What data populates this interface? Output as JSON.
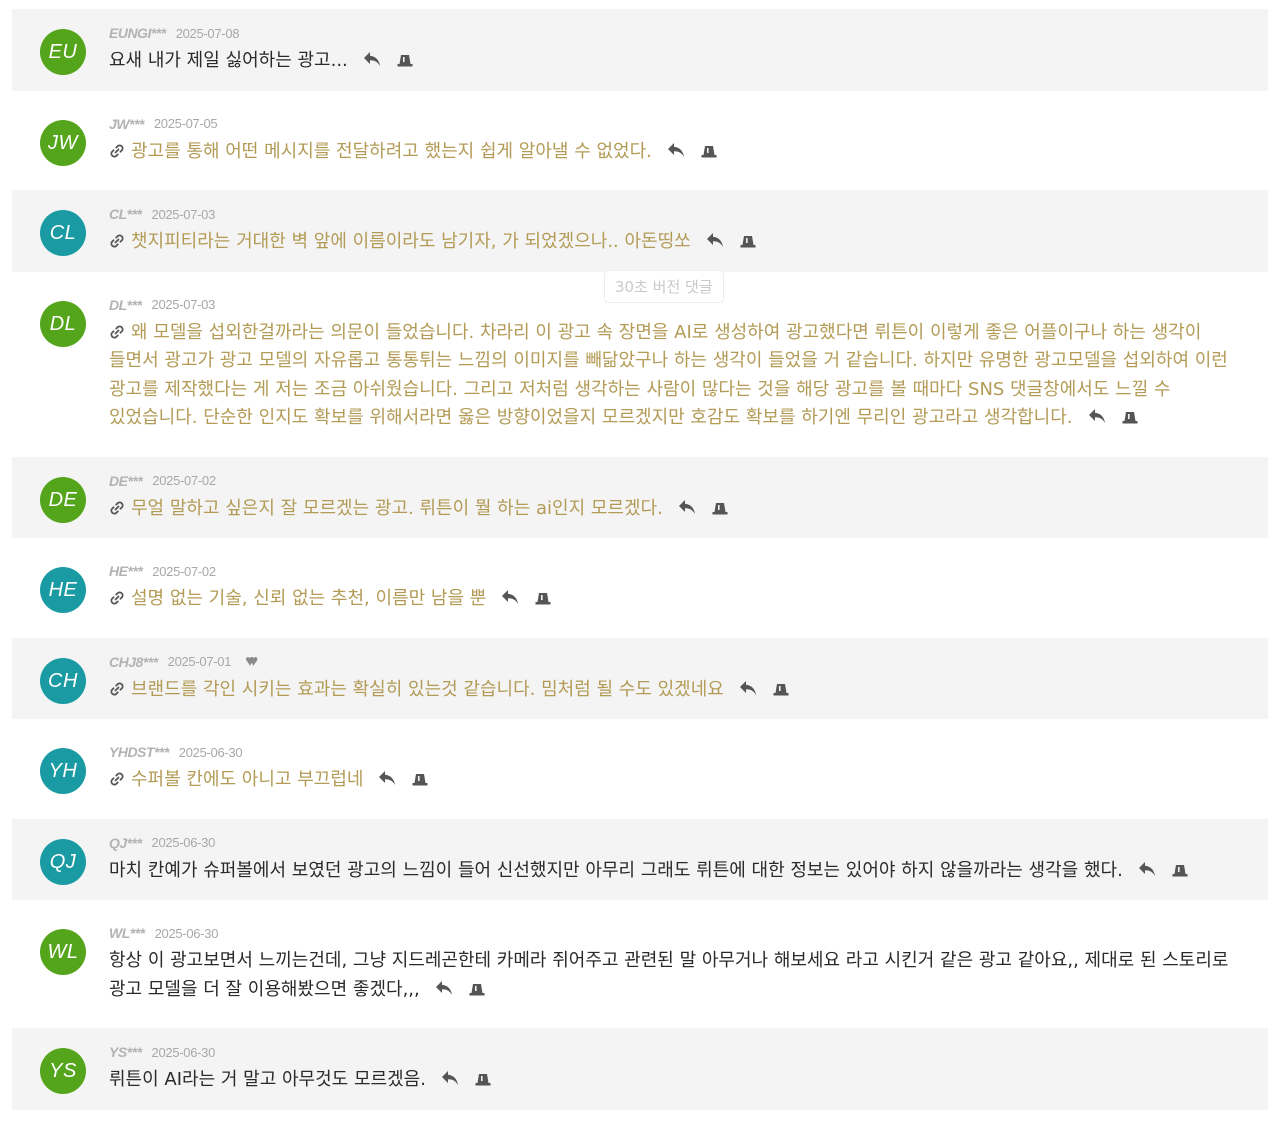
{
  "tooltip": {
    "text": "30초 버전 댓글"
  },
  "colors": {
    "avatar_green": "#55a51c",
    "avatar_teal": "#1a9aa3",
    "link_text": "#b39b56",
    "row_shaded": "#f4f4f4"
  },
  "icons": {
    "link": "link-icon",
    "reply": "reply-icon",
    "report": "siren-icon",
    "heart": "heart-icon"
  },
  "comments": [
    {
      "initials": "EU",
      "avatar_color": "green",
      "author": "EUNGI***",
      "date": "2025-07-08",
      "linked": false,
      "hearts": "",
      "text": "요새 내가 제일 싫어하는 광고..."
    },
    {
      "initials": "JW",
      "avatar_color": "green",
      "author": "JW***",
      "date": "2025-07-05",
      "linked": true,
      "hearts": "",
      "text": "광고를 통해 어떤 메시지를 전달하려고 했는지 쉽게 알아낼 수 없었다."
    },
    {
      "initials": "CL",
      "avatar_color": "teal",
      "author": "CL***",
      "date": "2025-07-03",
      "linked": true,
      "hearts": "",
      "text": "챗지피티라는 거대한 벽 앞에 이름이라도 남기자, 가 되었겠으나.. 아돈띵쏘"
    },
    {
      "initials": "DL",
      "avatar_color": "green",
      "author": "DL***",
      "date": "2025-07-03",
      "linked": true,
      "hearts": "",
      "text": "왜 모델을 섭외한걸까라는 의문이 들었습니다. 차라리 이 광고 속 장면을 AI로 생성하여 광고했다면 뤼튼이 이렇게 좋은 어플이구나 하는 생각이 들면서 광고가 광고 모델의 자유롭고 통통튀는 느낌의 이미지를 빼닮았구나 하는 생각이 들었을 거 같습니다. 하지만 유명한 광고모델을 섭외하여 이런 광고를 제작했다는 게 저는 조금 아쉬웠습니다. 그리고 저처럼 생각하는 사람이 많다는 것을 해당 광고를 볼 때마다 SNS 댓글창에서도 느낄 수 있었습니다. 단순한 인지도 확보를 위해서라면 옳은 방향이었을지 모르겠지만 호감도 확보를 하기엔 무리인 광고라고 생각합니다."
    },
    {
      "initials": "DE",
      "avatar_color": "green",
      "author": "DE***",
      "date": "2025-07-02",
      "linked": true,
      "hearts": "",
      "text": "무얼 말하고 싶은지 잘 모르겠는 광고. 뤼튼이 뭘 하는 ai인지 모르겠다."
    },
    {
      "initials": "HE",
      "avatar_color": "teal",
      "author": "HE***",
      "date": "2025-07-02",
      "linked": true,
      "hearts": "",
      "text": "설명 없는 기술, 신뢰 없는 추천, 이름만 남을 뿐"
    },
    {
      "initials": "CH",
      "avatar_color": "teal",
      "author": "CHJ8***",
      "date": "2025-07-01",
      "linked": true,
      "hearts": "♥♥",
      "text": "브랜드를 각인 시키는 효과는 확실히 있는것 같습니다. 밈처럼 될 수도 있겠네요"
    },
    {
      "initials": "YH",
      "avatar_color": "teal",
      "author": "YHDST***",
      "date": "2025-06-30",
      "linked": true,
      "hearts": "",
      "text": "수퍼볼 칸에도 아니고 부끄럽네"
    },
    {
      "initials": "QJ",
      "avatar_color": "teal",
      "author": "QJ***",
      "date": "2025-06-30",
      "linked": false,
      "hearts": "",
      "text": "마치 칸예가 슈퍼볼에서 보였던 광고의 느낌이 들어 신선했지만 아무리 그래도 뤼튼에 대한 정보는 있어야 하지 않을까라는 생각을 했다."
    },
    {
      "initials": "WL",
      "avatar_color": "green",
      "author": "WL***",
      "date": "2025-06-30",
      "linked": false,
      "hearts": "",
      "text": "항상 이 광고보면서 느끼는건데, 그냥 지드레곤한테 카메라 쥐어주고 관련된 말 아무거나 해보세요 라고 시킨거 같은 광고 같아요,, 제대로 된 스토리로 광고 모델을 더 잘 이용해봤으면 좋겠다,,,"
    },
    {
      "initials": "YS",
      "avatar_color": "green",
      "author": "YS***",
      "date": "2025-06-30",
      "linked": false,
      "hearts": "",
      "text": "뤼튼이 AI라는 거 말고 아무것도 모르겠음."
    }
  ]
}
